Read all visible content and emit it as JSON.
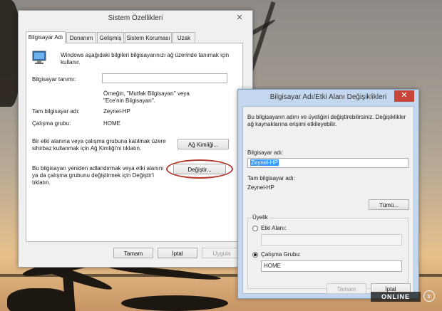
{
  "sysprops": {
    "title": "Sistem Özellikleri",
    "close": "✕",
    "tabs": [
      "Bilgisayar Adı",
      "Donanım",
      "Gelişmiş",
      "Sistem Koruması",
      "Uzak"
    ],
    "intro": "Windows aşağıdaki bilgileri bilgisayarınızı ağ üzerinde tanımak için kullanır.",
    "desc_label": "Bilgisayar tanımı:",
    "desc_value": "",
    "example": "Örneğin, \"Mutfak Bilgisayarı\" veya \"Ece'nin Bilgisayarı\".",
    "fullname_label": "Tam bilgisayar adı:",
    "fullname_value": "Zeynel-HP",
    "workgroup_label": "Çalışma grubu:",
    "workgroup_value": "HOME",
    "networkid_text": "Bir etki alanına veya çalışma grubuna katılmak üzere sihirbaz kullanmak için Ağ Kimliği'ni tıklatın.",
    "networkid_button": "Ağ Kimliği...",
    "rename_text": "Bu bilgisayarı yeniden adlandırmak veya etki alanını ya da çalışma grubunu değiştirmek için Değiştir'i tıklatın.",
    "change_button": "Değiştir...",
    "ok": "Tamam",
    "cancel": "İptal",
    "apply": "Uygula"
  },
  "dialog": {
    "title": "Bilgisayar Adı/Etki Alanı Değişiklikleri",
    "close": "✕",
    "intro": "Bu bilgisayarın adını ve üyeliğini değiştirebilirsiniz. Değişiklikler ağ kaynaklarına erişimi etkileyebilir.",
    "name_label": "Bilgisayar adı:",
    "name_value": "Zeynel-HP",
    "fullname_label": "Tam bilgisayar adı:",
    "fullname_value": "Zeynel-HP",
    "more_button": "Tümü...",
    "membership_label": "Üyelik",
    "domain_label": "Etki Alanı:",
    "domain_value": "",
    "workgroup_label": "Çalışma Grubu:",
    "workgroup_value": "HOME",
    "member_of": "workgroup",
    "ok": "Tamam",
    "cancel": "İptal"
  },
  "watermark": {
    "text": "ONLINE",
    "tld": "tr"
  },
  "colors": {
    "highlight": "#3399ff",
    "annotation": "#b33a2f",
    "close_red": "#c7453a"
  }
}
